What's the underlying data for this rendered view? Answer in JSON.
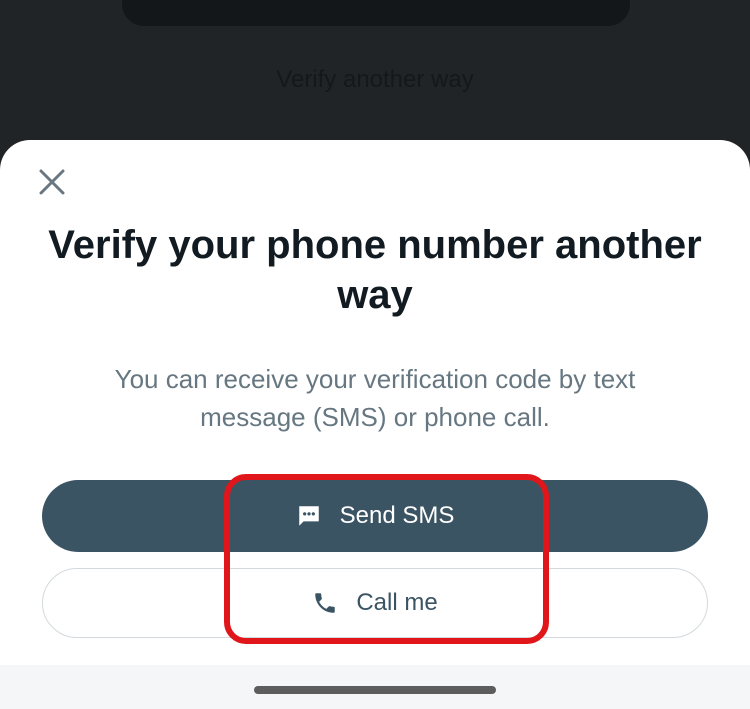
{
  "background": {
    "link_label": "Verify another way"
  },
  "sheet": {
    "close_icon": "close-icon",
    "title": "Verify your phone number another way",
    "subtitle": "You can receive your verification code by text message (SMS) or phone call.",
    "send_sms": {
      "label": "Send SMS",
      "icon": "message-icon"
    },
    "call_me": {
      "label": "Call me",
      "icon": "phone-icon"
    }
  },
  "colors": {
    "primary_button": "#3b5464",
    "highlight": "#e0161b",
    "title": "#111b21",
    "subtitle": "#667781"
  }
}
